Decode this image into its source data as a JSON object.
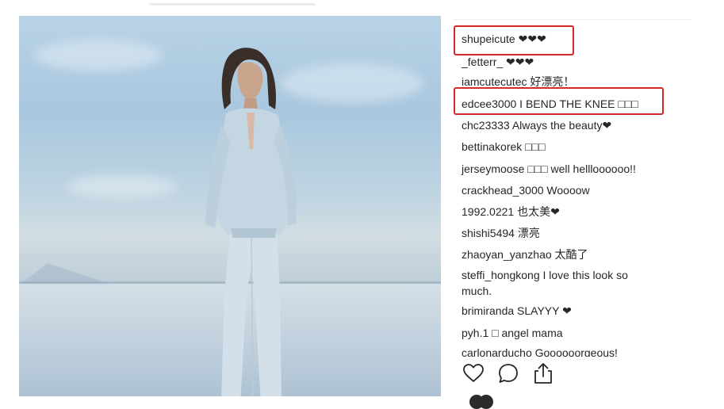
{
  "comments": [
    {
      "user": "shupeicute",
      "text": " ❤❤❤"
    },
    {
      "user": "_fetterr_",
      "text": " ❤❤❤"
    },
    {
      "user": "iamcutecutec",
      "text": " 好漂亮！"
    },
    {
      "user": "edcee3000",
      "text": " I BEND THE KNEE □□□"
    },
    {
      "user": "chc23333",
      "text": " Always the beauty❤"
    },
    {
      "user": "bettinakorek",
      "text": " □□□"
    },
    {
      "user": "jerseymoose",
      "text": " □□□ well hellloooooo!!"
    },
    {
      "user": "crackhead_3000",
      "text": " Woooow"
    },
    {
      "user": "1992.0221",
      "text": " 也太美❤"
    },
    {
      "user": "shishi5494",
      "text": " 漂亮"
    },
    {
      "user": "zhaoyan_yanzhao",
      "text": " 太酷了"
    },
    {
      "user": "steffi_hongkong",
      "text": " I love this look so much."
    },
    {
      "user": "brimiranda",
      "text": " SLAYYY ❤"
    },
    {
      "user": "pyh.1",
      "text": " □ angel mama"
    },
    {
      "user": "carlonarducho",
      "text": " Goooooorgeous!"
    }
  ],
  "actions": {
    "like_icon": "heart-icon",
    "comment_icon": "speech-bubble-icon",
    "share_icon": "share-icon"
  },
  "colors": {
    "highlight": "#d22a2a",
    "text": "#262626"
  }
}
